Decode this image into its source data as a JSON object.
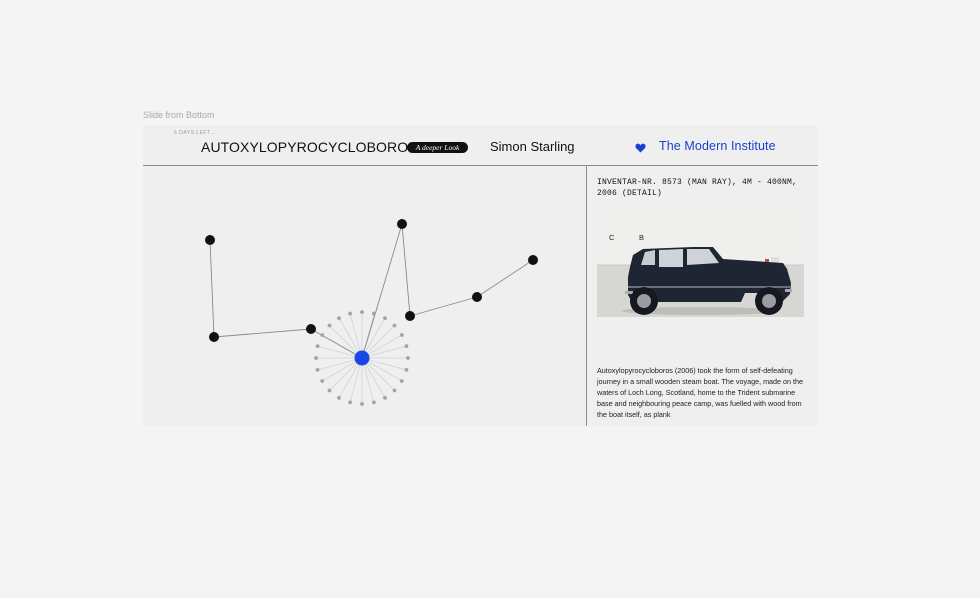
{
  "caption": "Slide from Bottom",
  "header": {
    "days_left": "5 DAYS LEFT...",
    "title": "AUTOXYLOPYROCYCLOBOROS",
    "pill_label": "A deeper Look",
    "artist": "Simon Starling",
    "heart_icon": "heart-icon",
    "gallery": "The Modern  Institute"
  },
  "colors": {
    "accent": "#1b3fce",
    "node": "#111111",
    "hub": "#1747e6",
    "satellite": "#a3a3a3",
    "background": "#f4f4f4",
    "panel": "#efefef"
  },
  "sidebar": {
    "work_label": "INVENTAR-NR. 8573 (MAN RAY), 4M - 400NM, 2006 (DETAIL)",
    "photo_letter_c": "C",
    "photo_letter_b": "B",
    "description": "Autoxylopyrocycloboros (2006) took the form of self-defeating journey in a small wooden steam boat. The voyage, made on the waters of Loch Long, Scotland, home to the Trident submarine base and neighbouring peace camp, was fuelled with wood from the boat itself, as plank"
  }
}
